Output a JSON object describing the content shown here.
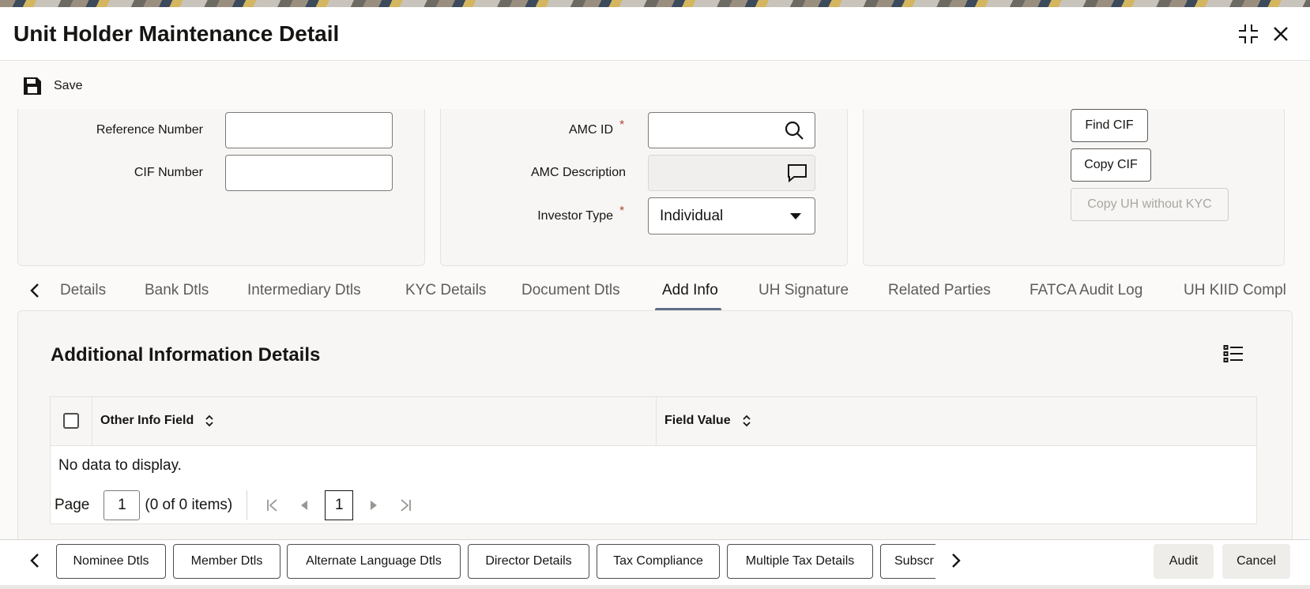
{
  "window": {
    "title": "Unit Holder Maintenance Detail",
    "icons": {
      "maximize": "expand-icon",
      "close": "close-icon"
    }
  },
  "toolbar": {
    "save_label": "Save",
    "save_icon": "floppy-disk-icon"
  },
  "form": {
    "reference_number": {
      "label": "Reference Number",
      "value": ""
    },
    "cif_number": {
      "label": "CIF Number",
      "value": ""
    },
    "amc_id": {
      "label": "AMC ID",
      "required": "*",
      "value": "",
      "icon": "search-icon"
    },
    "amc_description": {
      "label": "AMC Description",
      "value": "",
      "icon": "comment-icon"
    },
    "investor_type": {
      "label": "Investor Type",
      "required": "*",
      "selected": "Individual"
    },
    "buttons": {
      "find_cif": "Find CIF",
      "copy_cif": "Copy CIF",
      "copy_uh_without_kyc": "Copy UH without KYC"
    }
  },
  "tabs": [
    {
      "label": "Details"
    },
    {
      "label": "Bank Dtls"
    },
    {
      "label": "Intermediary Dtls"
    },
    {
      "label": "KYC Details"
    },
    {
      "label": "Document Dtls"
    },
    {
      "label": "Add Info",
      "active": true
    },
    {
      "label": "UH Signature"
    },
    {
      "label": "Related Parties"
    },
    {
      "label": "FATCA Audit Log"
    },
    {
      "label": "UH KIID Compl"
    }
  ],
  "section": {
    "title": "Additional Information Details",
    "columns": [
      "Other Info Field",
      "Field Value"
    ],
    "empty_message": "No data to display.",
    "pager": {
      "page_label": "Page",
      "page_value": "1",
      "items_text": "(0 of 0 items)",
      "current_page": "1"
    }
  },
  "footer": {
    "buttons": [
      "Nominee Dtls",
      "Member Dtls",
      "Alternate Language Dtls",
      "Director Details",
      "Tax Compliance",
      "Multiple Tax Details",
      "Subscr"
    ],
    "audit_label": "Audit",
    "cancel_label": "Cancel"
  },
  "colors": {
    "accent_underline": "#5f6f87",
    "text": "#161513",
    "required": "#b0483a"
  }
}
